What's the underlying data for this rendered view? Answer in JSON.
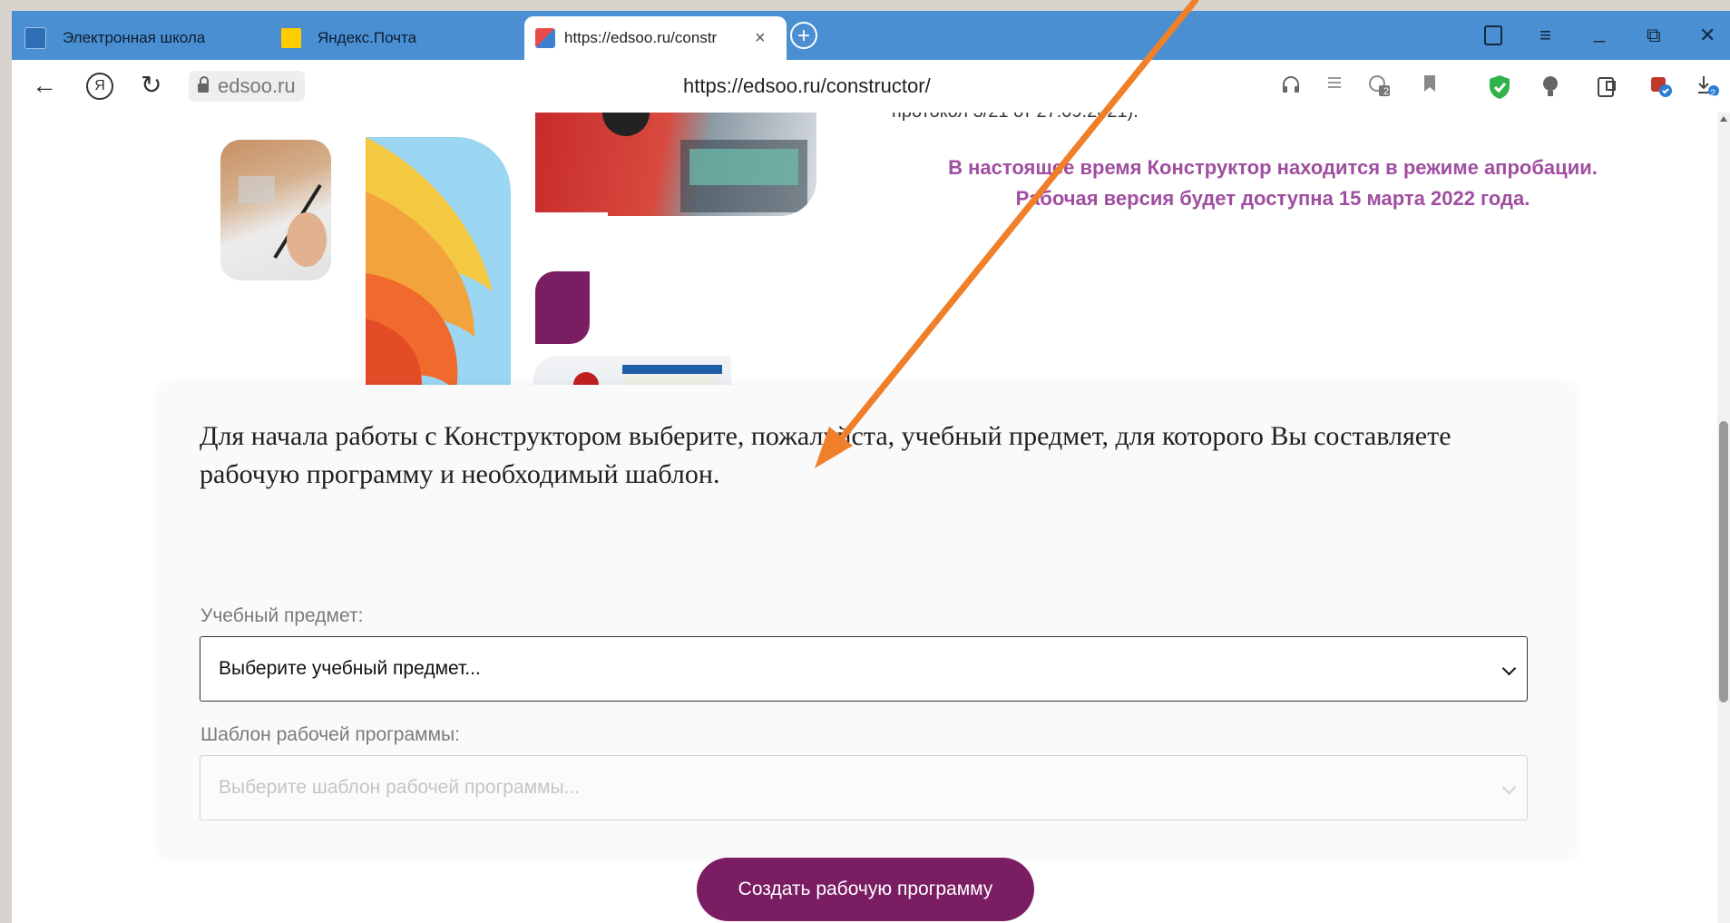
{
  "browser": {
    "tabs": [
      {
        "title": "Электронная школа"
      },
      {
        "title": "Яндекс.Почта"
      },
      {
        "title": "https://edsoo.ru/constr"
      }
    ],
    "new_tab_label": "+",
    "tab_close": "×",
    "window_controls": {
      "menu": "≡",
      "minimize": "_",
      "restore": "⧉",
      "close": "✕"
    },
    "site_chip": "edsoo.ru",
    "url": "https://edsoo.ru/constructor/",
    "nav": {
      "back": "←",
      "yandex": "Я",
      "reload": "↻"
    },
    "download_badge": "2",
    "toolbar_badge": "2"
  },
  "page": {
    "protocol_line": "протокол 3/21 от 27.09.2021).",
    "notice_line1": "В настоящее время Конструктор находится в режиме апробации.",
    "notice_line2": "Рабочая версия будет доступна 15 марта 2022 года.",
    "intro_text": "Для начала работы с Конструктором выберите, пожалуйста, учебный предмет, для которого Вы составляете рабочую программу и необходимый шаблон.",
    "subject_label": "Учебный предмет:",
    "subject_placeholder": "Выберите учебный предмет...",
    "template_label": "Шаблон рабочей программы:",
    "template_placeholder": "Выберите шаблон рабочей программы...",
    "create_button": "Создать рабочую программу"
  },
  "colors": {
    "tabbar": "#4a8fd1",
    "accent_purple": "#7a1d62",
    "notice_text": "#a04ea0",
    "arrow": "#f07f2a"
  }
}
